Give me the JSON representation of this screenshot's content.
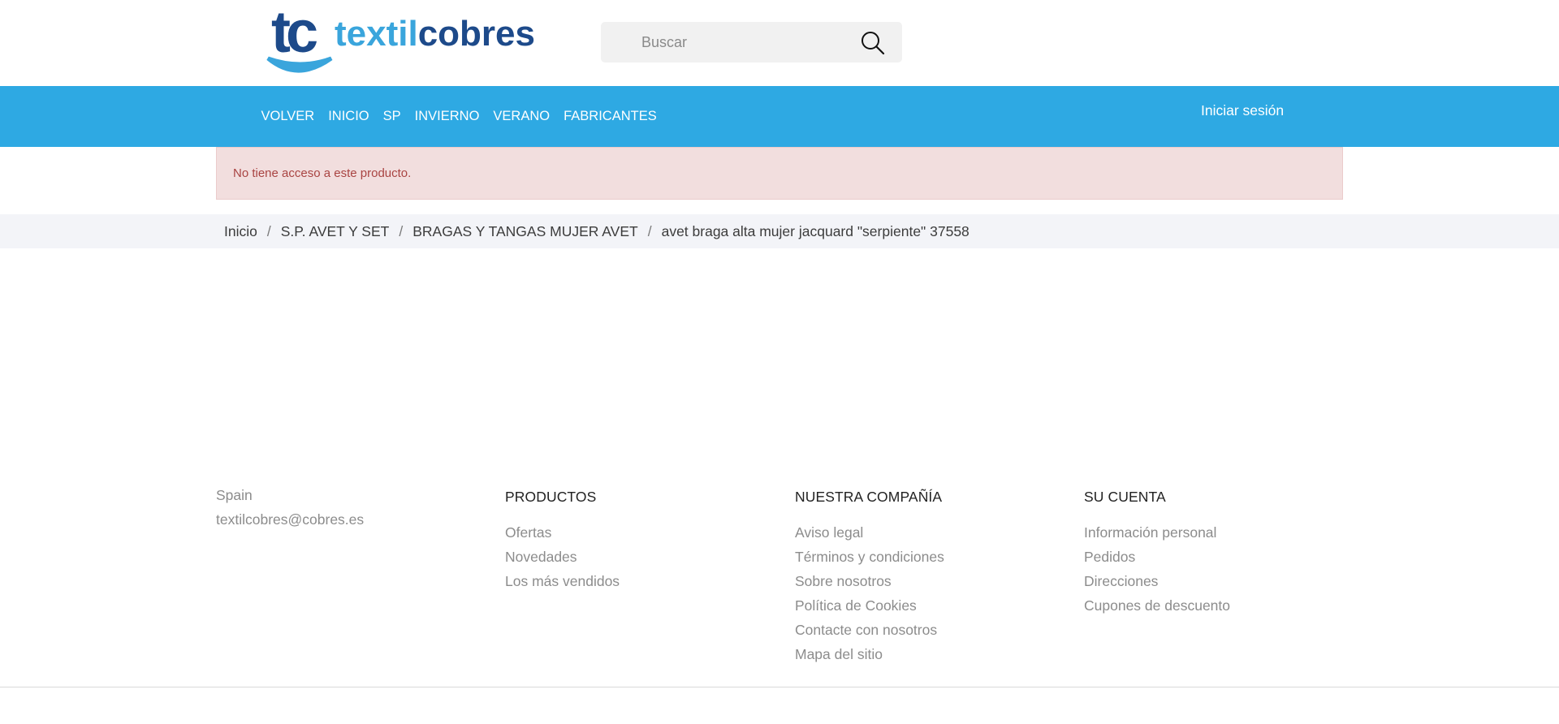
{
  "logo": {
    "mark": "tc",
    "text_light": "textil",
    "text_dark": "cobres"
  },
  "search": {
    "placeholder": "Buscar"
  },
  "nav": {
    "items": [
      {
        "label": "VOLVER"
      },
      {
        "label": "INICIO"
      },
      {
        "label": "SP"
      },
      {
        "label": "INVIERNO"
      },
      {
        "label": "VERANO"
      },
      {
        "label": "FABRICANTES"
      }
    ],
    "login_label": "Iniciar sesión"
  },
  "alert": {
    "message": "No tiene acceso a este producto."
  },
  "breadcrumb": {
    "items": [
      {
        "label": "Inicio"
      },
      {
        "label": "S.P. AVET Y SET"
      },
      {
        "label": "BRAGAS Y TANGAS MUJER AVET"
      },
      {
        "label": "avet braga alta mujer jacquard \"serpiente\" 37558"
      }
    ],
    "separator": "/"
  },
  "footer": {
    "contact": {
      "country": "Spain",
      "email": "textilcobres@cobres.es"
    },
    "products": {
      "title": "PRODUCTOS",
      "links": [
        "Ofertas",
        "Novedades",
        "Los más vendidos"
      ]
    },
    "company": {
      "title": "NUESTRA COMPAÑÍA",
      "links": [
        "Aviso legal",
        "Términos y condiciones",
        "Sobre nosotros",
        "Política de Cookies",
        "Contacte con nosotros",
        "Mapa del sitio"
      ]
    },
    "account": {
      "title": "SU CUENTA",
      "links": [
        "Información personal",
        "Pedidos",
        "Direcciones",
        "Cupones de descuento"
      ]
    }
  },
  "colors": {
    "nav_bg": "#2ea9e3",
    "logo_dark": "#1d4a8a",
    "logo_light": "#3aa5dc",
    "alert_bg": "#f2dede",
    "alert_text": "#a94442"
  }
}
